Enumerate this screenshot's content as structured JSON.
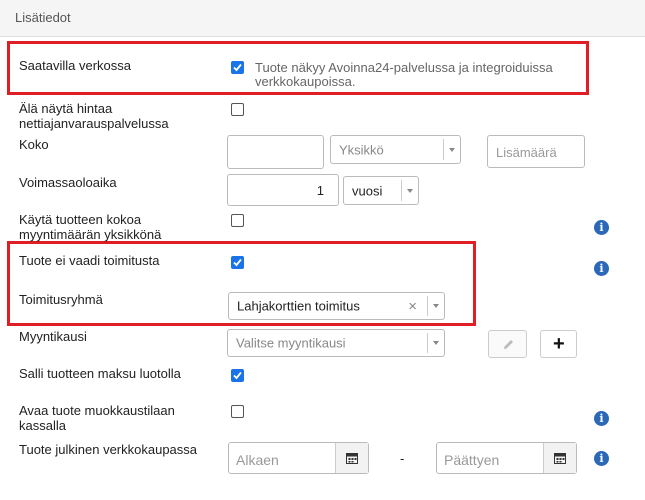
{
  "header": {
    "title": "Lisätiedot"
  },
  "rows": {
    "saatavilla": {
      "label": "Saatavilla verkossa",
      "checked": true,
      "help": "Tuote näkyy Avoinna24-palvelussa ja integroiduissa verkkokaupoissa."
    },
    "ala_nayta": {
      "label_line1": "Älä näytä hintaa",
      "label_line2": "nettiajanvarauspalvelussa",
      "checked": false
    },
    "koko": {
      "label": "Koko",
      "value": "",
      "unit_placeholder": "Yksikkö",
      "lisamaara_placeholder": "Lisämäärä"
    },
    "voimassaolo": {
      "label": "Voimassaoloaika",
      "value": "1",
      "unit": "vuosi"
    },
    "kayta": {
      "label_line1": "Käytä tuotteen kokoa",
      "label_line2": "myyntimäärän yksikkönä",
      "checked": false
    },
    "ei_toimitusta": {
      "label": "Tuote ei vaadi toimitusta",
      "checked": true
    },
    "toimitusryhma": {
      "label": "Toimitusryhmä",
      "value": "Lahjakorttien toimitus",
      "clear": "×"
    },
    "myyntikausi": {
      "label": "Myyntikausi",
      "placeholder": "Valitse myyntikausi",
      "add": "+"
    },
    "salli": {
      "label": "Salli tuotteen maksu luotolla",
      "checked": true
    },
    "avaa": {
      "label_line1": "Avaa tuote muokkaustilaan",
      "label_line2": "kassalla",
      "checked": false
    },
    "julkinen": {
      "label": "Tuote julkinen verkkokaupassa",
      "start_placeholder": "Alkaen",
      "dash": "-",
      "end_placeholder": "Päättyen"
    }
  },
  "info_glyph": "i",
  "colors": {
    "accent": "#1a73e8",
    "highlight": "#e01e25",
    "info": "#2b68b8"
  }
}
